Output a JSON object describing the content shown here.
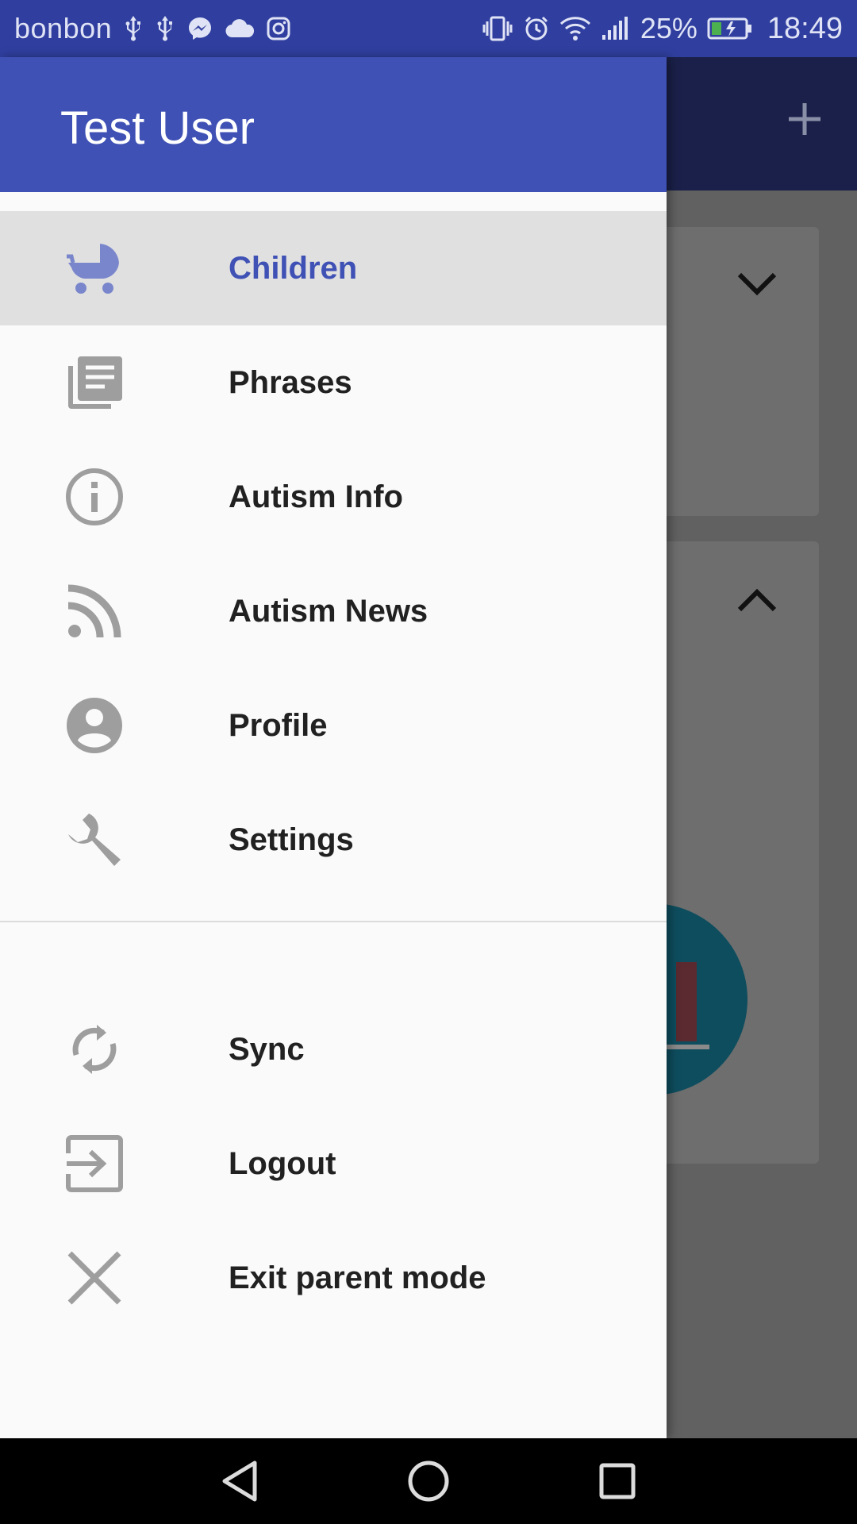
{
  "status_bar": {
    "carrier": "bonbon",
    "battery_percent": "25%",
    "time": "18:49",
    "icons_left": [
      "usb-icon",
      "usb-icon",
      "messenger-icon",
      "cloud-icon",
      "instagram-icon"
    ],
    "icons_right": [
      "vibrate-icon",
      "alarm-icon",
      "wifi-icon",
      "signal-icon",
      "battery-icon"
    ]
  },
  "drawer": {
    "user_name": "Test User",
    "primary_items": [
      {
        "label": "Children",
        "icon": "stroller-icon",
        "active": true
      },
      {
        "label": "Phrases",
        "icon": "library-books-icon",
        "active": false
      },
      {
        "label": "Autism Info",
        "icon": "info-icon",
        "active": false
      },
      {
        "label": "Autism News",
        "icon": "rss-feed-icon",
        "active": false
      },
      {
        "label": "Profile",
        "icon": "account-circle-icon",
        "active": false
      },
      {
        "label": "Settings",
        "icon": "wrench-icon",
        "active": false
      }
    ],
    "secondary_items": [
      {
        "label": "Sync",
        "icon": "sync-icon"
      },
      {
        "label": "Logout",
        "icon": "exit-to-app-icon"
      },
      {
        "label": "Exit parent mode",
        "icon": "close-icon"
      }
    ]
  },
  "colors": {
    "status_bar": "#303f9f",
    "drawer_header": "#3f51b5",
    "active_label": "#3f51b5",
    "active_bg": "#e0e0e0",
    "icon_gray": "#9e9e9e"
  },
  "nav_bar": [
    "back-icon",
    "home-icon",
    "recents-icon"
  ]
}
